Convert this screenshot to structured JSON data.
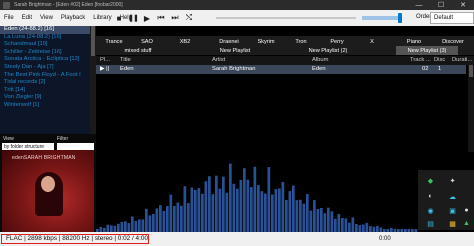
{
  "window": {
    "title": "Sarah Brightman - [Eden #02] Eden  [foobar2000]",
    "minimize": "—",
    "maximize": "☐",
    "close": "✕"
  },
  "menu": [
    "File",
    "Edit",
    "View",
    "Playback",
    "Library",
    "Help"
  ],
  "toolbar": {
    "buttons": [
      "stop-icon",
      "pause-icon",
      "play-icon",
      "previous-icon",
      "next-icon",
      "random-icon"
    ],
    "order_label": "Orden",
    "order_value": "Default",
    "volume_level": 0.9
  },
  "sidebar": {
    "playlists": [
      "Eden (24-88.2) [16]",
      "La Luna (24-88.2) [16]",
      "Schandmaul [19]",
      "Schiller - Zeitreise [16]",
      "Sonata Arctica - Ecliptica [12]",
      "Steely Dan - Aja [7]",
      "The Best Pink Floyd - A Foot I",
      "Tidal records [2]",
      "Tritt [14]",
      "Von Ziegler [9]",
      "Winterwolf [1]"
    ],
    "selected_index": 0,
    "view_label": "View",
    "filter_label": "Filter",
    "view_value": "by folder structure",
    "album_art_text": "edenSARAH BRIGHTMAN"
  },
  "tabs": {
    "row1": [
      "Trance",
      "SAO",
      "XB2",
      "Draenei",
      "Skyrim",
      "Tron",
      "Perry",
      "X",
      "Piano",
      "Discover"
    ],
    "row2": [
      "mixed stuff",
      "New Playlist",
      "New Playlist (2)",
      "New Playlist (3)"
    ],
    "active": "New Playlist (3)"
  },
  "playlist": {
    "columns": [
      "Pl...",
      "Title",
      "Artist",
      "Album",
      "Track ...",
      "Disc",
      "Durati..."
    ],
    "rows": [
      {
        "playing": "▶ ||",
        "title": "Eden",
        "artist": "Sarah Brightman",
        "album": "Eden",
        "track": "02",
        "disc": "1",
        "duration": ""
      }
    ]
  },
  "status": {
    "text": "FLAC | 2898 kbps | 88200 Hz | stereo | 0:02 / 4:00",
    "time": "0:00"
  },
  "colors": {
    "accent": "#0078d7",
    "selection": "#3b4a66",
    "playlist_text": "#1f86c7",
    "spectrum": "#2f5fb0",
    "status_border": "#e02020"
  },
  "tray_icons": [
    "wifi-icon",
    "bluetooth-icon",
    "headphones-icon",
    "cloud-icon",
    "speaker-icon",
    "display-icon",
    "folder-icon",
    "network-icon",
    "shield-icon",
    "camera-icon"
  ]
}
